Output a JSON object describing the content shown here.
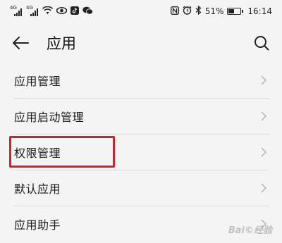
{
  "status_bar": {
    "signal1_label": "4G",
    "signal2_label": "4G",
    "battery_percent": "51%",
    "battery_level": 0.51,
    "time": "16:14",
    "icons": [
      "signal-icon",
      "signal-icon",
      "wifi-icon",
      "eye-icon",
      "tiktok-icon",
      "wechat-icon",
      "nfc-icon",
      "alarm-icon",
      "bluetooth-icon",
      "battery-icon"
    ]
  },
  "header": {
    "title": "应用",
    "back_icon": "arrow-left-icon",
    "search_icon": "search-icon"
  },
  "list": {
    "items": [
      {
        "label": "应用管理"
      },
      {
        "label": "应用启动管理"
      },
      {
        "label": "权限管理",
        "highlighted": true
      },
      {
        "label": "默认应用"
      },
      {
        "label": "应用助手"
      }
    ]
  },
  "highlight_color": "#c8252c"
}
